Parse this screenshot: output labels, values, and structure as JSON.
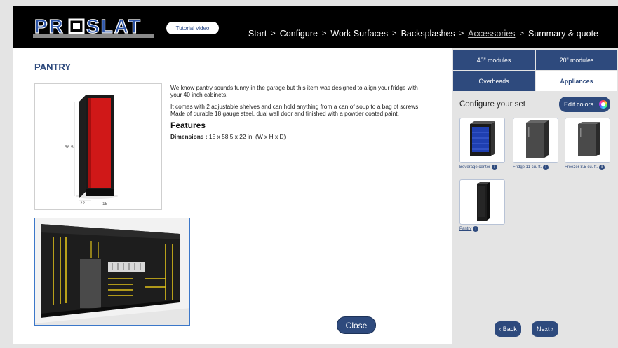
{
  "header": {
    "logo_text": "PROSLAT",
    "tutorial_label": "Tutorial video",
    "nav": [
      {
        "label": "Start"
      },
      {
        "label": "Configure"
      },
      {
        "label": "Work Surfaces"
      },
      {
        "label": "Backsplashes"
      },
      {
        "label": "Accessories"
      },
      {
        "label": "Summary & quote"
      }
    ],
    "nav_separator": ">"
  },
  "product": {
    "title": "PANTRY",
    "dim_height": "58.5",
    "dim_width": "22",
    "dim_depth": "15",
    "paragraph1": "We know pantry sounds funny in the garage but this item was designed to align your fridge with your 40 inch cabinets.",
    "paragraph2": "It comes with 2 adjustable shelves and can hold anything from a can of soup to a bag of screws. Made of durable 18 gauge steel, dual wall door and finished with a powder coated paint.",
    "features_heading": "Features",
    "dimensions_label": "Dimensions :",
    "dimensions_value": "15 x 58.5 x 22 in. (W x H x D)",
    "close_label": "Close"
  },
  "sidebar": {
    "tabs": [
      {
        "label": "40\" modules"
      },
      {
        "label": "20\" modules"
      },
      {
        "label": "Overheads"
      },
      {
        "label": "Appliances",
        "active": true
      }
    ],
    "configure_title": "Configure your set",
    "edit_colors_label": "Edit colors",
    "items": [
      {
        "label": "Beverage center"
      },
      {
        "label": "Fridge 11 cu. ft."
      },
      {
        "label": "Freezer 8.5 cu. ft."
      },
      {
        "label": "Pantry"
      }
    ],
    "info_glyph": "i",
    "back_label": "‹ Back",
    "next_label": "Next ›"
  },
  "colors": {
    "brand_navy": "#2e4a7d",
    "cabinet_red": "#d01818",
    "header_black": "#000000"
  }
}
